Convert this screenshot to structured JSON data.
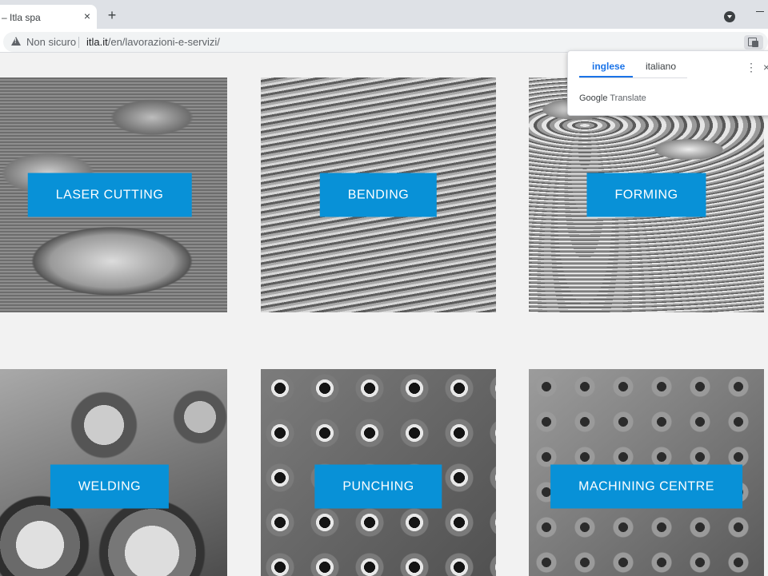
{
  "browser": {
    "tab_title": "– Itla spa",
    "tab_close": "×",
    "new_tab": "+",
    "security_label": "Non sicuro",
    "url_domain": "itla.it",
    "url_path": "/en/lavorazioni-e-servizi/"
  },
  "translate_popup": {
    "tab_source": "inglese",
    "tab_target": "italiano",
    "menu": "⋮",
    "close": "×",
    "brand_google": "Google",
    "brand_translate": "Translate"
  },
  "services": [
    {
      "label": "LASER CUTTING"
    },
    {
      "label": "BENDING"
    },
    {
      "label": "FORMING"
    },
    {
      "label": "WELDING"
    },
    {
      "label": "PUNCHING"
    },
    {
      "label": "MACHINING CENTRE"
    }
  ]
}
